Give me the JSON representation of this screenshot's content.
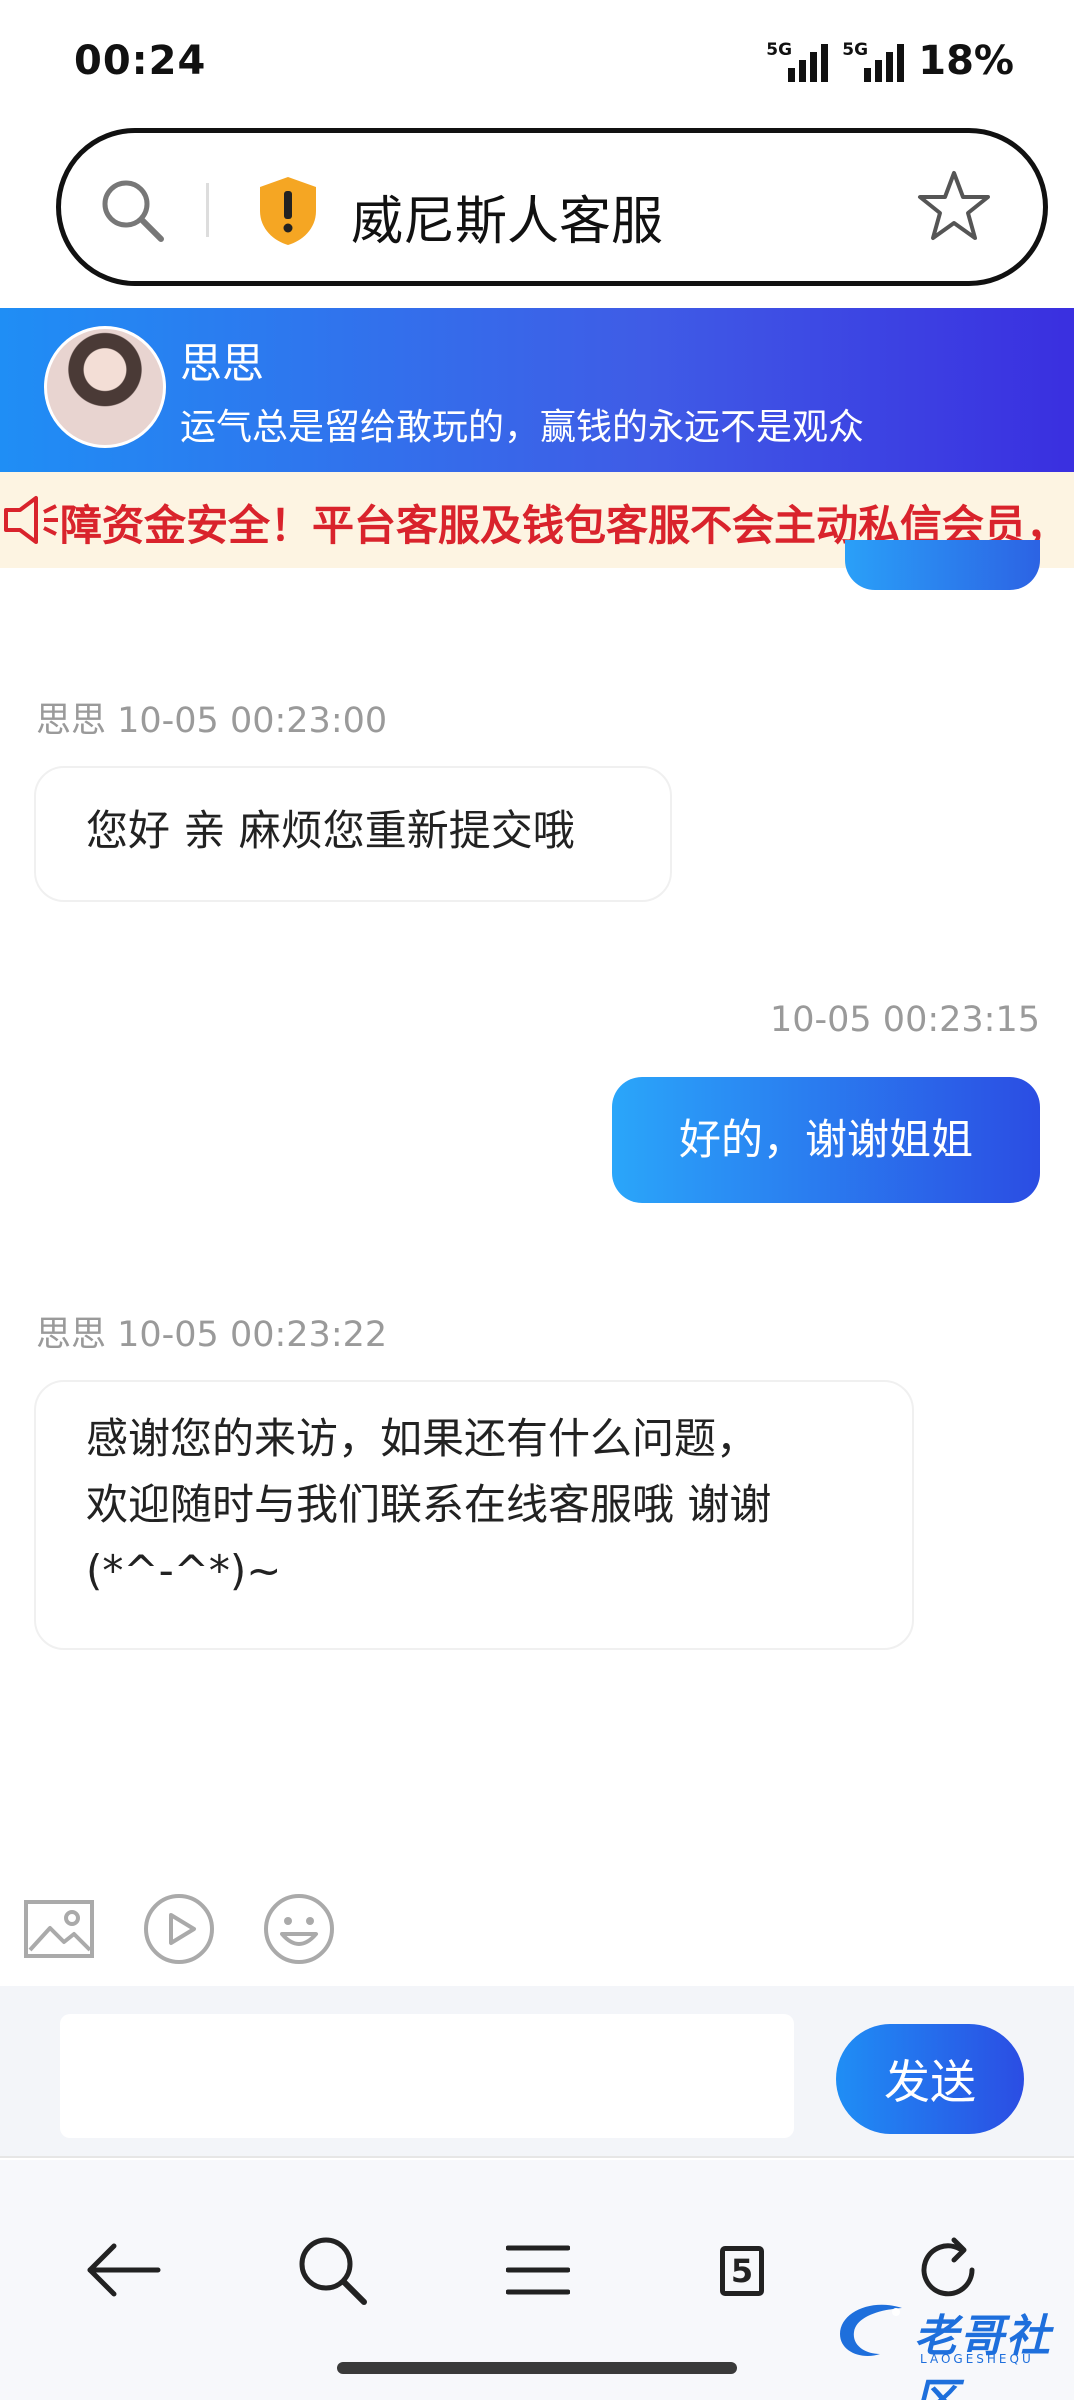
{
  "status_bar": {
    "time": "00:24",
    "network_1": "5G",
    "network_2": "5G",
    "battery": "18%"
  },
  "search_bar": {
    "title": "威尼斯人客服",
    "icons": [
      "search-icon",
      "shield-icon",
      "star-icon"
    ]
  },
  "agent": {
    "name": "思思",
    "motto": "运气总是留给敢玩的，赢钱的永远不是观众"
  },
  "notice": {
    "text": "障资金安全！平台客服及钱包客服不会主动私信会员，"
  },
  "messages": [
    {
      "side": "in",
      "meta": "思思 10-05 00:23:00",
      "text": "您好 亲 麻烦您重新提交哦"
    },
    {
      "side": "out",
      "meta": "10-05 00:23:15",
      "text": "好的，谢谢姐姐"
    },
    {
      "side": "in",
      "meta": "思思 10-05 00:23:22",
      "lines": [
        "感谢您的来访，如果还有什么问题，",
        "欢迎随时与我们联系在线客服哦 谢谢",
        "(*^-^*)~"
      ]
    }
  ],
  "toolbar": {
    "icons": [
      "image-icon",
      "video-icon",
      "emoji-icon"
    ]
  },
  "composer": {
    "input_value": "",
    "send_label": "发送"
  },
  "browser_nav": {
    "tab_count": "5",
    "icons": [
      "back-arrow-icon",
      "search-icon",
      "menu-icon",
      "tabs-icon",
      "refresh-icon"
    ]
  },
  "watermark": {
    "text": "老哥社区",
    "sub": "LAOGESHEQU"
  },
  "colors": {
    "accent_start": "#1f8ef5",
    "accent_end": "#3a2fe0",
    "notice_text": "#d9232c",
    "notice_bg": "#fdf4e2",
    "shield": "#f5a623"
  }
}
